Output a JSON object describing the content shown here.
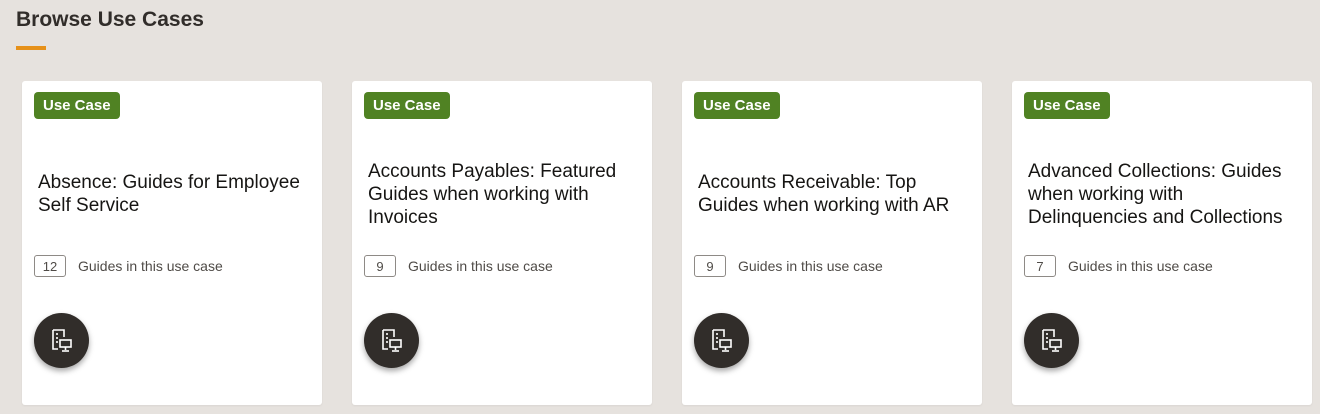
{
  "page": {
    "title": "Browse Use Cases"
  },
  "colors": {
    "accent_underline": "#e6911a",
    "badge_bg": "#508223",
    "fab_bg": "#312d2a",
    "background": "#e6e2de"
  },
  "cards": [
    {
      "badge": "Use Case",
      "title": "Absence: Guides for Employee Self Service",
      "count": "12",
      "count_label": "Guides in this use case",
      "action_icon": "guide-monitor-icon"
    },
    {
      "badge": "Use Case",
      "title": "Accounts Payables: Featured Guides when working with Invoices",
      "count": "9",
      "count_label": "Guides in this use case",
      "action_icon": "guide-monitor-icon"
    },
    {
      "badge": "Use Case",
      "title": "Accounts Receivable: Top Guides when working with AR",
      "count": "9",
      "count_label": "Guides in this use case",
      "action_icon": "guide-monitor-icon"
    },
    {
      "badge": "Use Case",
      "title": "Advanced Collections: Guides when working with Delinquencies and Collections",
      "count": "7",
      "count_label": "Guides in this use case",
      "action_icon": "guide-monitor-icon"
    }
  ]
}
